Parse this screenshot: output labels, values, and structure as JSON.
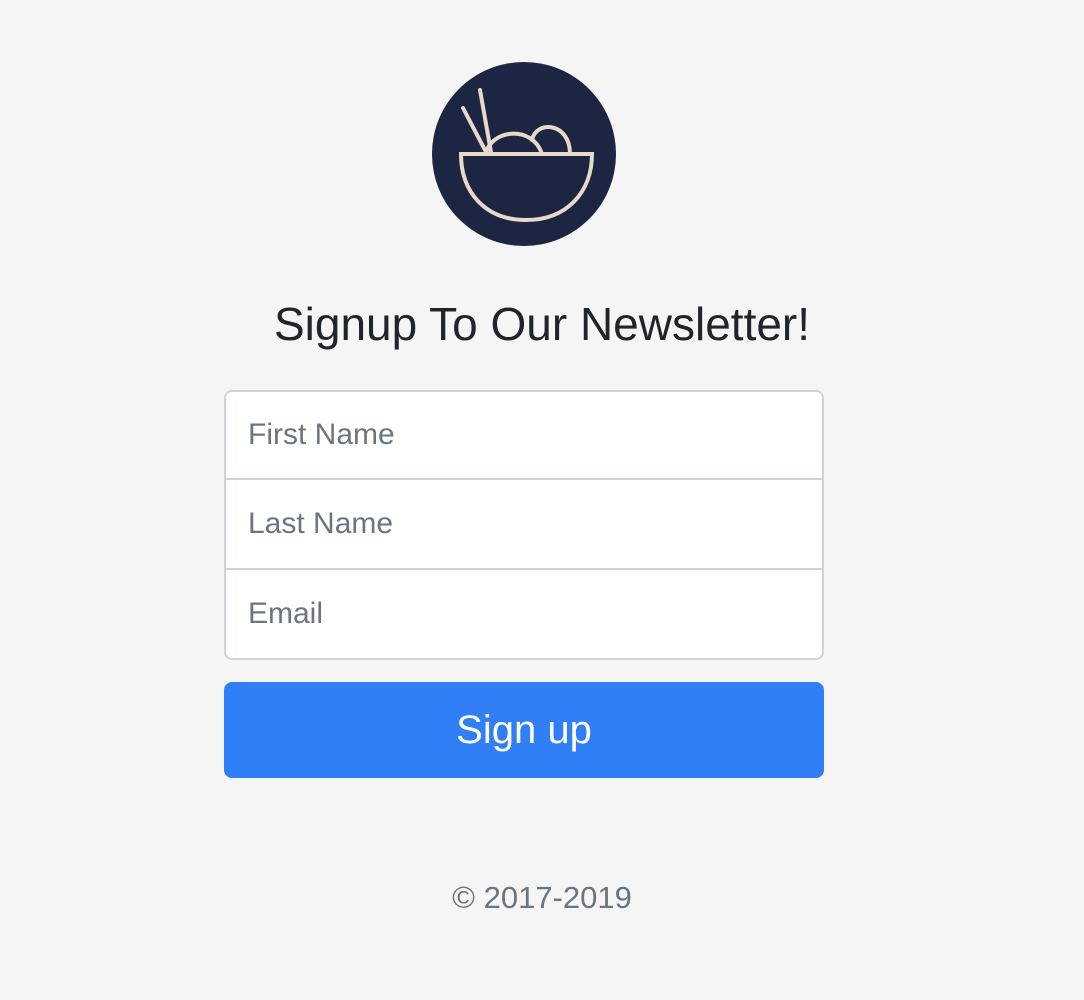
{
  "brand": {
    "logo_icon": "rice-bowl-icon",
    "logo_bg_color": "#1c2541",
    "logo_line_color": "#e8d9c8"
  },
  "page": {
    "title": "Signup To Our Newsletter!"
  },
  "form": {
    "first_name_placeholder": "First Name",
    "last_name_placeholder": "Last Name",
    "email_placeholder": "Email",
    "submit_label": "Sign up",
    "submit_color": "#307ff7"
  },
  "footer": {
    "copyright": "© 2017-2019"
  }
}
